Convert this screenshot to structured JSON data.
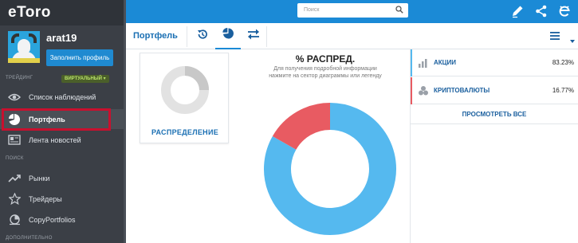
{
  "brand": {
    "logo": "eToro"
  },
  "profile": {
    "username": "arat19",
    "fill_profile": "Заполнить профиль"
  },
  "trading": {
    "label": "ТРЕЙДИНГ",
    "mode": "ВИРТУАЛЬНЫЙ ▾"
  },
  "nav": {
    "watchlist": "Список наблюдений",
    "portfolio": "Портфель",
    "news": "Лента новостей",
    "search_section": "ПОИСК",
    "markets": "Рынки",
    "traders": "Трейдеры",
    "copyportfolios": "CopyPortfolios",
    "more_section": "ДОПОЛНИТЕЛЬНО"
  },
  "search": {
    "placeholder": "Поиск"
  },
  "toolbar": {
    "title": "Портфель"
  },
  "mini_card": {
    "label": "РАСПРЕДЕЛЕНИЕ"
  },
  "chart": {
    "title": "% РАСПРЕД.",
    "subtitle": "Для получения подробной информации нажмите на сектор диаграммы или легенду"
  },
  "chart_data": {
    "type": "pie",
    "categories": [
      "АКЦИИ",
      "КРИПТОВАЛЮТЫ"
    ],
    "values": [
      83.23,
      16.77
    ],
    "colors": [
      "#55b9ef",
      "#e85b62"
    ]
  },
  "legend": [
    {
      "name": "АКЦИИ",
      "value": "83.23%",
      "color": "#55b9ef",
      "icon": "stocks-icon"
    },
    {
      "name": "КРИПТОВАЛЮТЫ",
      "value": "16.77%",
      "color": "#e85b62",
      "icon": "crypto-icon"
    }
  ],
  "view_all": "ПРОСМОТРЕТЬ ВСЕ"
}
